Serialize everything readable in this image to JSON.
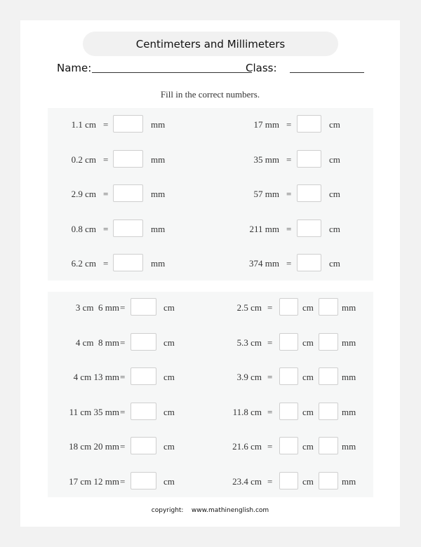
{
  "title": "Centimeters and Millimeters",
  "name_label": "Name:",
  "class_label": "Class:",
  "instruction": "Fill in the correct numbers.",
  "equals": "=",
  "section1": {
    "left": [
      {
        "given": "1.1 cm",
        "answer_unit": "mm"
      },
      {
        "given": "0.2 cm",
        "answer_unit": "mm"
      },
      {
        "given": "2.9 cm",
        "answer_unit": "mm"
      },
      {
        "given": "0.8 cm",
        "answer_unit": "mm"
      },
      {
        "given": "6.2 cm",
        "answer_unit": "mm"
      }
    ],
    "right": [
      {
        "given": "17 mm",
        "answer_unit": "cm"
      },
      {
        "given": "35 mm",
        "answer_unit": "cm"
      },
      {
        "given": "57 mm",
        "answer_unit": "cm"
      },
      {
        "given": "211 mm",
        "answer_unit": "cm"
      },
      {
        "given": "374 mm",
        "answer_unit": "cm"
      }
    ]
  },
  "section2": {
    "left": [
      {
        "given": "3 cm  6 mm",
        "answer_unit": "cm"
      },
      {
        "given": "4 cm  8 mm",
        "answer_unit": "cm"
      },
      {
        "given": "4 cm 13 mm",
        "answer_unit": "cm"
      },
      {
        "given": "11 cm 35 mm",
        "answer_unit": "cm"
      },
      {
        "given": "18 cm 20 mm",
        "answer_unit": "cm"
      },
      {
        "given": "17 cm 12 mm",
        "answer_unit": "cm"
      }
    ],
    "right": [
      {
        "given": "2.5 cm",
        "unit1": "cm",
        "unit2": "mm"
      },
      {
        "given": "5.3 cm",
        "unit1": "cm",
        "unit2": "mm"
      },
      {
        "given": "3.9 cm",
        "unit1": "cm",
        "unit2": "mm"
      },
      {
        "given": "11.8 cm",
        "unit1": "cm",
        "unit2": "mm"
      },
      {
        "given": "21.6 cm",
        "unit1": "cm",
        "unit2": "mm"
      },
      {
        "given": "23.4 cm",
        "unit1": "cm",
        "unit2": "mm"
      }
    ]
  },
  "footer": {
    "copyright_label": "copyright:",
    "website": "www.mathinenglish.com"
  }
}
